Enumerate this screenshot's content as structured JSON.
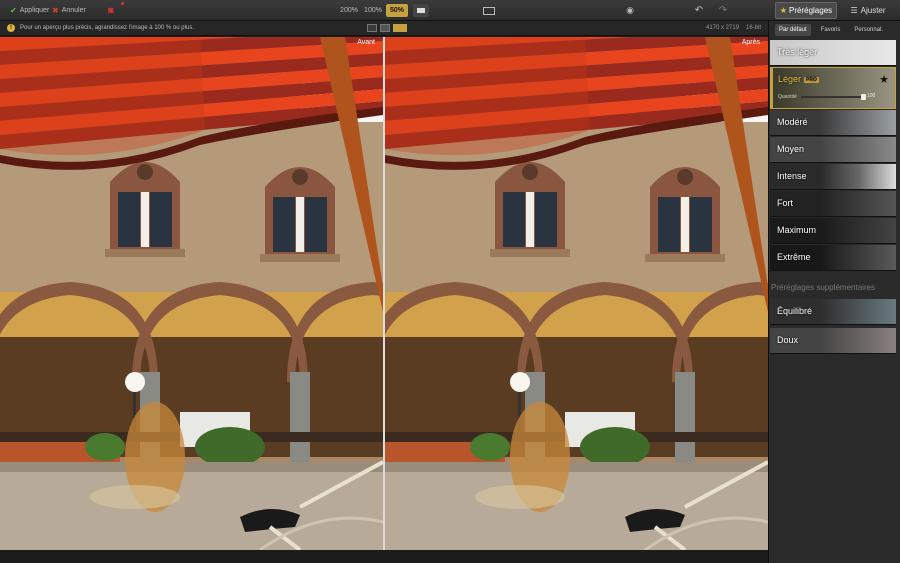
{
  "toolbar": {
    "apply_label": "Appliquer",
    "cancel_label": "Annuler",
    "zoom_200": "200%",
    "zoom_100": "100%",
    "zoom_50": "50%",
    "presets_label": "Préréglages",
    "adjust_label": "Ajuster"
  },
  "infobar": {
    "warning": "Pour un aperçu plus précis, agrandissez l'image à 100 % ou plus.",
    "dimensions": "4170 x 2719",
    "bit_depth": "16-bit"
  },
  "panes": {
    "before_label": "Avant",
    "after_label": "Après"
  },
  "sidebar": {
    "tabs": [
      "Par défaut",
      "Favoris",
      "Personnal."
    ],
    "active_tab": 0,
    "presets": [
      {
        "label": "Très léger"
      },
      {
        "label": "Léger",
        "badge": "PRO",
        "selected": true
      },
      {
        "label": "Modéré"
      },
      {
        "label": "Moyen"
      },
      {
        "label": "Intense"
      },
      {
        "label": "Fort"
      },
      {
        "label": "Maximum"
      },
      {
        "label": "Extrême"
      }
    ],
    "amount_label": "Quantité",
    "amount_value": "100",
    "amount_fraction": 1.0,
    "extra_section_title": "Préréglages supplémentaires",
    "extra_presets": [
      {
        "label": "Équilibré"
      },
      {
        "label": "Doux"
      }
    ]
  },
  "colors": {
    "accent": "#c7a13f",
    "apply_icon": "#5fbf3f",
    "cancel_icon": "#d04030"
  }
}
